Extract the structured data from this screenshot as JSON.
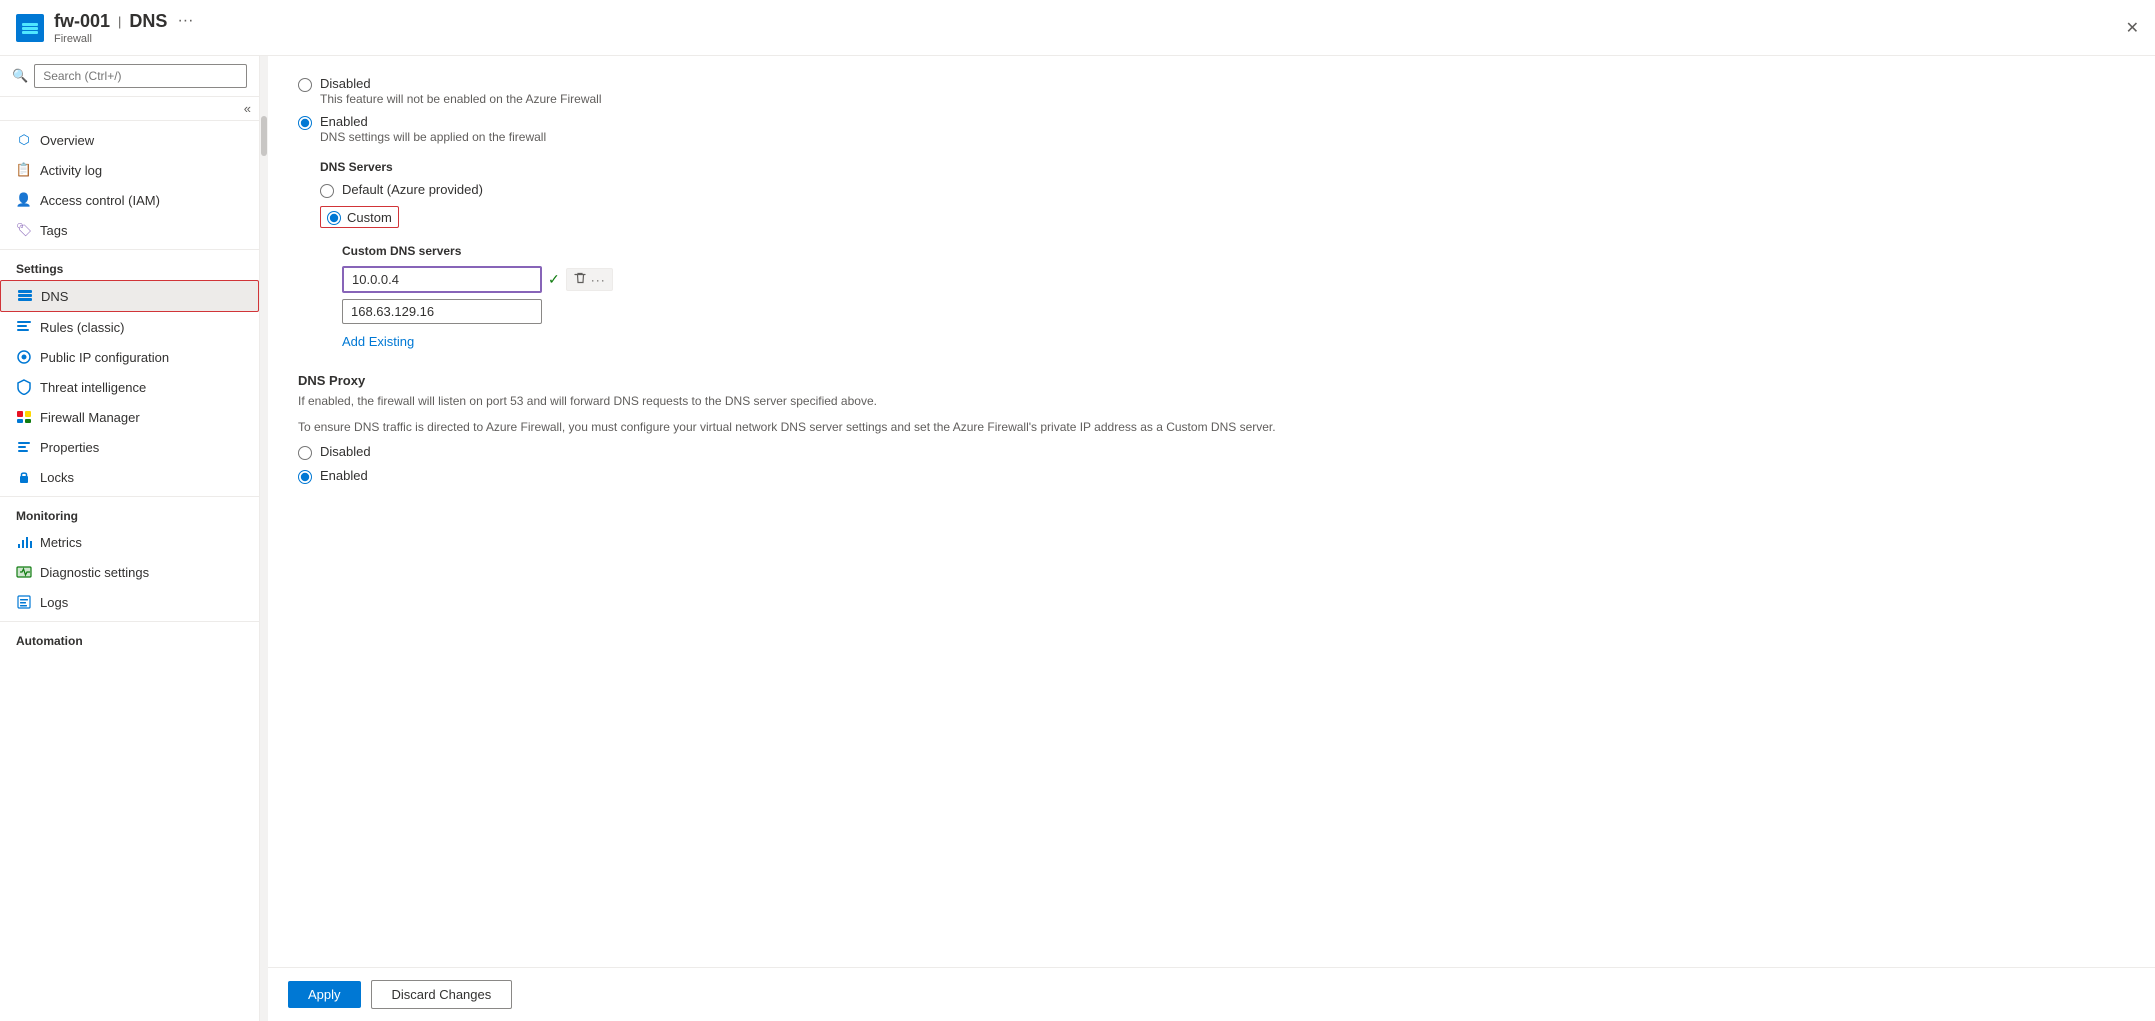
{
  "header": {
    "icon_label": "fw-icon",
    "resource_name": "fw-001",
    "separator": "|",
    "page_title": "DNS",
    "subtitle": "Firewall",
    "more_label": "···",
    "close_label": "✕"
  },
  "sidebar": {
    "search_placeholder": "Search (Ctrl+/)",
    "collapse_label": "«",
    "nav_items": [
      {
        "id": "overview",
        "label": "Overview",
        "icon": "overview"
      },
      {
        "id": "activity-log",
        "label": "Activity log",
        "icon": "activity"
      },
      {
        "id": "access-control",
        "label": "Access control (IAM)",
        "icon": "iam"
      },
      {
        "id": "tags",
        "label": "Tags",
        "icon": "tags"
      }
    ],
    "settings_header": "Settings",
    "settings_items": [
      {
        "id": "dns",
        "label": "DNS",
        "icon": "dns",
        "active": true
      },
      {
        "id": "rules-classic",
        "label": "Rules (classic)",
        "icon": "rules"
      },
      {
        "id": "public-ip",
        "label": "Public IP configuration",
        "icon": "pip"
      },
      {
        "id": "threat-intel",
        "label": "Threat intelligence",
        "icon": "threat"
      },
      {
        "id": "firewall-manager",
        "label": "Firewall Manager",
        "icon": "fwmgr"
      },
      {
        "id": "properties",
        "label": "Properties",
        "icon": "props"
      },
      {
        "id": "locks",
        "label": "Locks",
        "icon": "locks"
      }
    ],
    "monitoring_header": "Monitoring",
    "monitoring_items": [
      {
        "id": "metrics",
        "label": "Metrics",
        "icon": "metrics"
      },
      {
        "id": "diagnostic",
        "label": "Diagnostic settings",
        "icon": "diag"
      },
      {
        "id": "logs",
        "label": "Logs",
        "icon": "logs"
      }
    ],
    "automation_header": "Automation"
  },
  "main": {
    "dns_mode_label": "DNS Servers",
    "disabled_label": "Disabled",
    "disabled_desc": "This feature will not be enabled on the Azure Firewall",
    "enabled_label": "Enabled",
    "enabled_desc": "DNS settings will be applied on the firewall",
    "dns_servers_label": "DNS Servers",
    "default_label": "Default (Azure provided)",
    "custom_label": "Custom",
    "custom_dns_servers_title": "Custom DNS servers",
    "dns_entry_1": "10.0.0.4",
    "dns_entry_2": "168.63.129.16",
    "add_existing_label": "Add Existing",
    "proxy_title": "DNS Proxy",
    "proxy_desc_1": "If enabled, the firewall will listen on port 53 and will forward DNS requests to the DNS server specified above.",
    "proxy_desc_2": "To ensure DNS traffic is directed to Azure Firewall, you must configure your virtual network DNS server settings and set the Azure Firewall's private IP address as a Custom DNS server.",
    "proxy_disabled_label": "Disabled",
    "proxy_enabled_label": "Enabled"
  },
  "footer": {
    "apply_label": "Apply",
    "discard_label": "Discard Changes"
  }
}
